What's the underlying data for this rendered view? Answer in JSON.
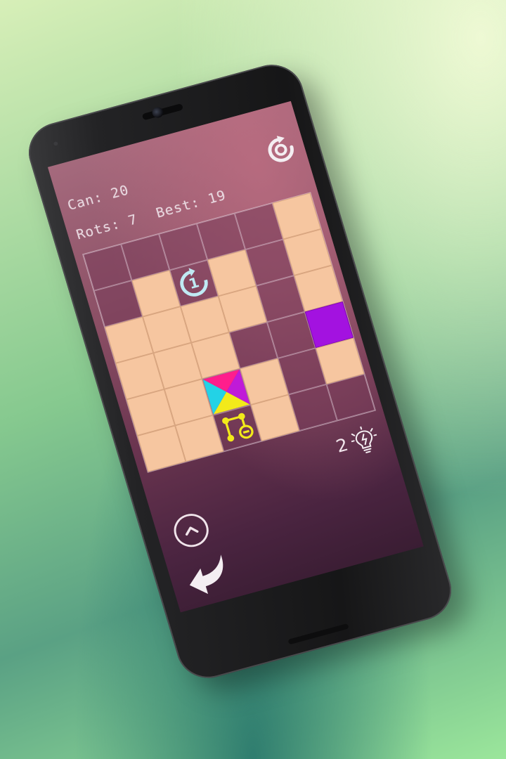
{
  "hud": {
    "can_label": "Can:",
    "can_value": "20",
    "rots_label": "Rots:",
    "rots_value": "7",
    "best_label": "Best:",
    "best_value": "19"
  },
  "board": {
    "rows": 6,
    "cols": 6,
    "cells": [
      [
        "empty",
        "empty",
        "empty",
        "empty",
        "empty",
        "tile"
      ],
      [
        "empty",
        "tile",
        "rotate",
        "tile",
        "empty",
        "tile"
      ],
      [
        "tile",
        "tile",
        "tile",
        "tile",
        "empty",
        "tile"
      ],
      [
        "tile",
        "tile",
        "tile",
        "empty",
        "empty",
        "goal"
      ],
      [
        "tile",
        "tile",
        "player",
        "tile",
        "empty",
        "tile"
      ],
      [
        "tile",
        "tile",
        "node",
        "tile",
        "empty",
        "empty"
      ]
    ],
    "rotate_tile_label": "1",
    "colors": {
      "tile": "#f6c6a0",
      "goal": "#a312e0",
      "player_top": "#ff1e8c",
      "player_right": "#c01ad8",
      "player_bottom": "#f2ea1a",
      "player_left": "#23d2e6",
      "node": "#f2ea1a",
      "rotate_ring": "#bfeaf4"
    }
  },
  "hint": {
    "count": "2",
    "icon": "lightbulb-icon"
  },
  "controls": {
    "restart_icon": "restart-icon",
    "up_icon": "chevron-up-icon",
    "back_icon": "back-arrow-icon"
  }
}
